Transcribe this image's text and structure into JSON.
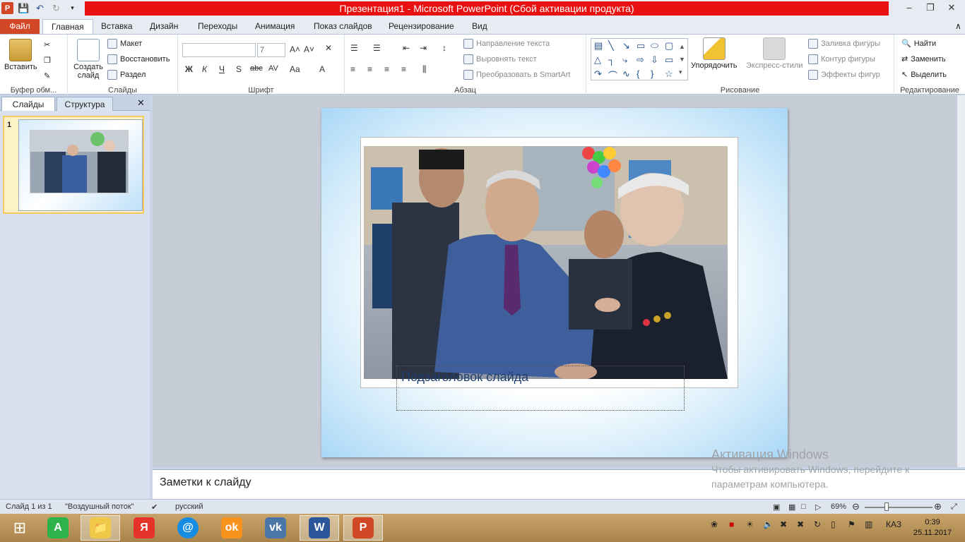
{
  "window": {
    "title": "Презентация1 - Microsoft PowerPoint (Сбой активации продукта)"
  },
  "tabs": [
    "Файл",
    "Главная",
    "Вставка",
    "Дизайн",
    "Переходы",
    "Анимация",
    "Показ слайдов",
    "Рецензирование",
    "Вид"
  ],
  "ribbon": {
    "clipboard": {
      "paste": "Вставить",
      "label": "Буфер обм..."
    },
    "slides": {
      "new_slide": "Создать слайд",
      "layout": "Макет",
      "reset": "Восстановить",
      "section": "Раздел",
      "label": "Слайды"
    },
    "font": {
      "font_name": "",
      "font_size": "7",
      "label": "Шрифт",
      "buttons": [
        "Ж",
        "К",
        "Ч",
        "S",
        "abc",
        "AV",
        "Aa",
        "A"
      ]
    },
    "paragraph": {
      "text_direction": "Направление текста",
      "align_text": "Выровнять текст",
      "smartart": "Преобразовать в SmartArt",
      "label": "Абзац"
    },
    "drawing": {
      "arrange": "Упорядочить",
      "quick_styles": "Экспресс-стили",
      "fill": "Заливка фигуры",
      "outline": "Контур фигуры",
      "effects": "Эффекты фигур",
      "label": "Рисование"
    },
    "editing": {
      "find": "Найти",
      "replace": "Заменить",
      "select": "Выделить",
      "label": "Редактирование"
    }
  },
  "left_pane": {
    "tab_slides": "Слайды",
    "tab_outline": "Структура",
    "slide_number": "1"
  },
  "slide": {
    "subtitle_placeholder": "Подзаголовок слайда"
  },
  "notes": {
    "placeholder": "Заметки к слайду"
  },
  "activation": {
    "heading": "Активация Windows",
    "line1": "Чтобы активировать Windows, перейдите к",
    "line2": "параметрам компьютера."
  },
  "status": {
    "slide_info": "Слайд 1 из 1",
    "theme": "\"Воздушный поток\"",
    "language": "русский",
    "zoom": "69%"
  },
  "taskbar": {
    "lang": "КАЗ",
    "time": "0:39",
    "date": "25.11.2017"
  },
  "colors": {
    "file_tab": "#d24726",
    "title_bar": "#e81010",
    "slide_gradient_edge": "#a9d7f7"
  }
}
